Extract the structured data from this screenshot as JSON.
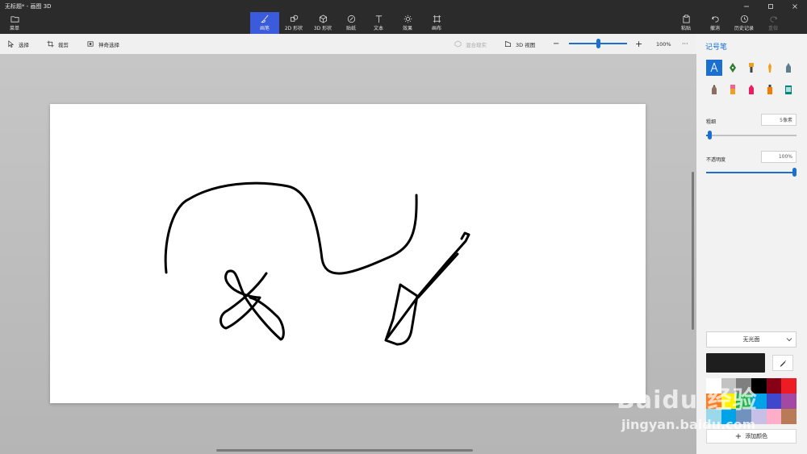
{
  "window": {
    "title": "无标题* - 画图 3D"
  },
  "ribbon": {
    "menu": "菜单",
    "tools": [
      {
        "label": "画笔",
        "icon": "brush-icon",
        "active": true
      },
      {
        "label": "2D 形状",
        "icon": "shapes-2d-icon"
      },
      {
        "label": "3D 形状",
        "icon": "shapes-3d-icon"
      },
      {
        "label": "贴纸",
        "icon": "sticker-icon"
      },
      {
        "label": "文本",
        "icon": "text-icon"
      },
      {
        "label": "效果",
        "icon": "effects-icon"
      },
      {
        "label": "画布",
        "icon": "canvas-icon"
      }
    ],
    "paste": "粘贴",
    "undo": "撤消",
    "history": "历史记录",
    "redo": "重做"
  },
  "subtoolbar": {
    "select": "选择",
    "crop": "裁剪",
    "magic_select": "神奇选择",
    "mixed_reality": "混合现实",
    "view_3d": "3D 视图",
    "zoom_minus": "−",
    "zoom_plus": "+",
    "zoom_value": "100%",
    "zoom_level": 0.5,
    "more": "···"
  },
  "panel": {
    "title": "记号笔",
    "thickness_label": "粗细",
    "thickness_value": "5像素",
    "thickness_level": 0.04,
    "opacity_label": "不透明度",
    "opacity_value": "100%",
    "opacity_level": 1.0,
    "finish": "无光面",
    "current_color": "#1e1e1e",
    "palette": [
      "#ffffff",
      "#c3c3c3",
      "#7f7f7f",
      "#000000",
      "#880015",
      "#ed1c24",
      "#ff7f27",
      "#fff200",
      "#22b14c",
      "#00a2e8",
      "#3f48cc",
      "#a349a4",
      "#99d9ea",
      "#00a2e8",
      "#7092be",
      "#c8bfe7",
      "#ffaec9",
      "#b97a57"
    ],
    "add_color": "添加颜色"
  },
  "watermark": {
    "logo": "Baidu 经验",
    "site": "jingyan.baidu.com"
  }
}
